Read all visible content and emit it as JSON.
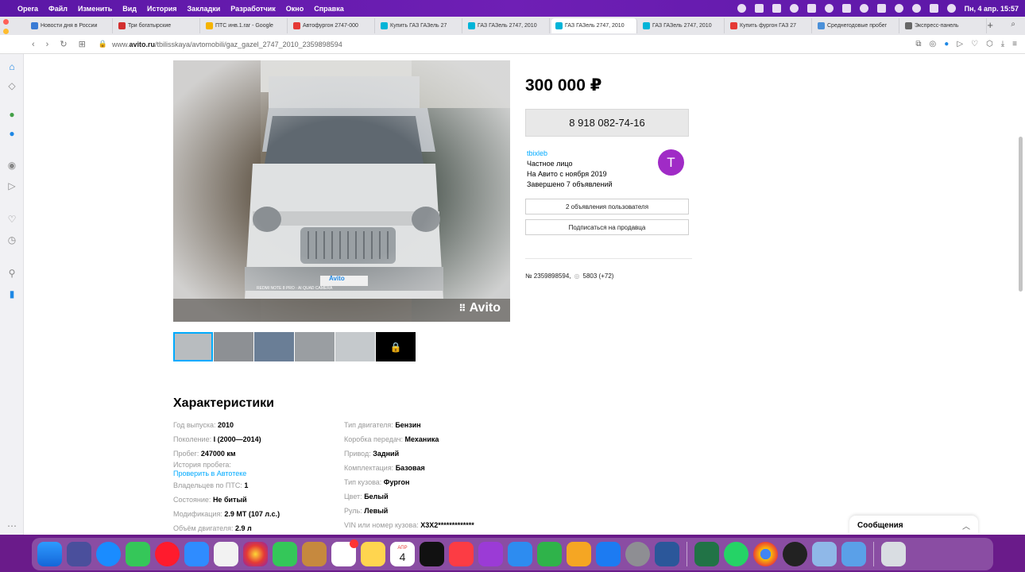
{
  "menubar": {
    "app": "Opera",
    "items": [
      "Файл",
      "Изменить",
      "Вид",
      "История",
      "Закладки",
      "Разработчик",
      "Окно",
      "Справка"
    ],
    "clock": "Пн, 4 апр. 15:57"
  },
  "tabs": [
    {
      "label": "Новости дня в России",
      "color": "#3a7bd5"
    },
    {
      "label": "Три богатырские",
      "color": "#d32f2f"
    },
    {
      "label": "ПТС инв.1.rar - Google",
      "color": "#f5b400"
    },
    {
      "label": "Автофургон 2747-000",
      "color": "#e53935"
    },
    {
      "label": "Купить ГАЗ ГАЗель 27",
      "color": "#00b4d8"
    },
    {
      "label": "ГАЗ ГАЗель 2747, 2010",
      "color": "#00b4d8"
    },
    {
      "label": "ГАЗ ГАЗель 2747, 2010",
      "color": "#00b4d8",
      "active": true
    },
    {
      "label": "ГАЗ ГАЗель 2747, 2010",
      "color": "#00b4d8"
    },
    {
      "label": "Купить фургон ГАЗ 27",
      "color": "#e53935"
    },
    {
      "label": "Среднегодовые пробег",
      "color": "#4a90d9"
    },
    {
      "label": "Экспресс-панель",
      "color": "#666"
    }
  ],
  "address": {
    "prefix": "www.",
    "domain": "avito.ru",
    "path": "/tbilisskaya/avtomobili/gaz_gazel_2747_2010_2359898594"
  },
  "listing": {
    "price": "300 000 ₽",
    "phone": "8 918 082-74-16",
    "seller_name": "tbixleb",
    "seller_type": "Частное лицо",
    "seller_since": "На Авито с ноября 2019",
    "seller_done": "Завершено 7 объявлений",
    "avatar_letter": "T",
    "user_ads_button": "2 объявления пользователя",
    "subscribe_button": "Подписаться на продавца",
    "ad_number": "№ 2359898594,",
    "views": "5803 (+72)",
    "photo_watermark": "Avito",
    "plate_text": "Avito",
    "camera_watermark": "REDMI NOTE 8 PRO · AI QUAD CAMERA"
  },
  "specs": {
    "title": "Характеристики",
    "left": [
      {
        "k": "Год выпуска:",
        "v": "2010"
      },
      {
        "k": "Поколение:",
        "v": "I (2000—2014)"
      },
      {
        "k": "Пробег:",
        "v": "247000 км"
      },
      {
        "k": "История пробега:",
        "link": "Проверить в Автотеке"
      },
      {
        "k": "Владельцев по ПТС:",
        "v": "1"
      },
      {
        "k": "Состояние:",
        "v": "Не битый"
      },
      {
        "k": "Модификация:",
        "v": "2.9 MT (107 л.с.)"
      },
      {
        "k": "Объём двигателя:",
        "v": "2.9 л"
      }
    ],
    "right": [
      {
        "k": "Тип двигателя:",
        "v": "Бензин"
      },
      {
        "k": "Коробка передач:",
        "v": "Механика"
      },
      {
        "k": "Привод:",
        "v": "Задний"
      },
      {
        "k": "Комплектация:",
        "v": "Базовая"
      },
      {
        "k": "Тип кузова:",
        "v": "Фургон"
      },
      {
        "k": "Цвет:",
        "v": "Белый"
      },
      {
        "k": "Руль:",
        "v": "Левый"
      },
      {
        "k": "VIN или номер кузова:",
        "v": "X3X2*************"
      }
    ]
  },
  "messages": {
    "label": "Сообщения"
  },
  "dock_calendar": {
    "month": "АПР",
    "day": "4"
  }
}
